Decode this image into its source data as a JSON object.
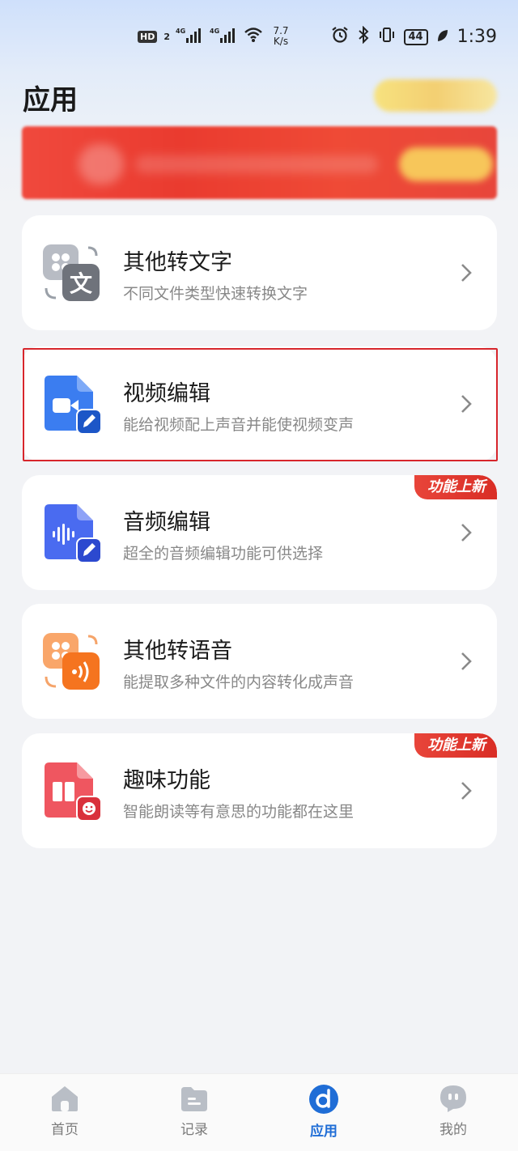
{
  "status_bar": {
    "hd": "HD",
    "sim": "2",
    "net1": "4G",
    "net2": "4G",
    "speed_value": "7.7",
    "speed_unit": "K/s",
    "battery": "44",
    "time": "1:39"
  },
  "page": {
    "title": "应用"
  },
  "cards": [
    {
      "title": "其他转文字",
      "subtitle": "不同文件类型快速转换文字",
      "icon": "text-convert-icon",
      "tag": ""
    },
    {
      "title": "视频编辑",
      "subtitle": "能给视频配上声音并能使视频变声",
      "icon": "video-edit-icon",
      "tag": ""
    },
    {
      "title": "音频编辑",
      "subtitle": "超全的音频编辑功能可供选择",
      "icon": "audio-edit-icon",
      "tag": "功能上新"
    },
    {
      "title": "其他转语音",
      "subtitle": "能提取多种文件的内容转化成声音",
      "icon": "speech-convert-icon",
      "tag": ""
    },
    {
      "title": "趣味功能",
      "subtitle": "智能朗读等有意思的功能都在这里",
      "icon": "fun-feature-icon",
      "tag": "功能上新"
    }
  ],
  "tabbar": {
    "items": [
      {
        "label": "首页",
        "icon": "home-icon",
        "active": false
      },
      {
        "label": "记录",
        "icon": "folder-icon",
        "active": false
      },
      {
        "label": "应用",
        "icon": "apps-icon",
        "active": true
      },
      {
        "label": "我的",
        "icon": "profile-icon",
        "active": false
      }
    ]
  },
  "colors": {
    "accent": "#1f6dd6",
    "tag_red": "#e03a30",
    "highlight_border": "#d7262c"
  }
}
